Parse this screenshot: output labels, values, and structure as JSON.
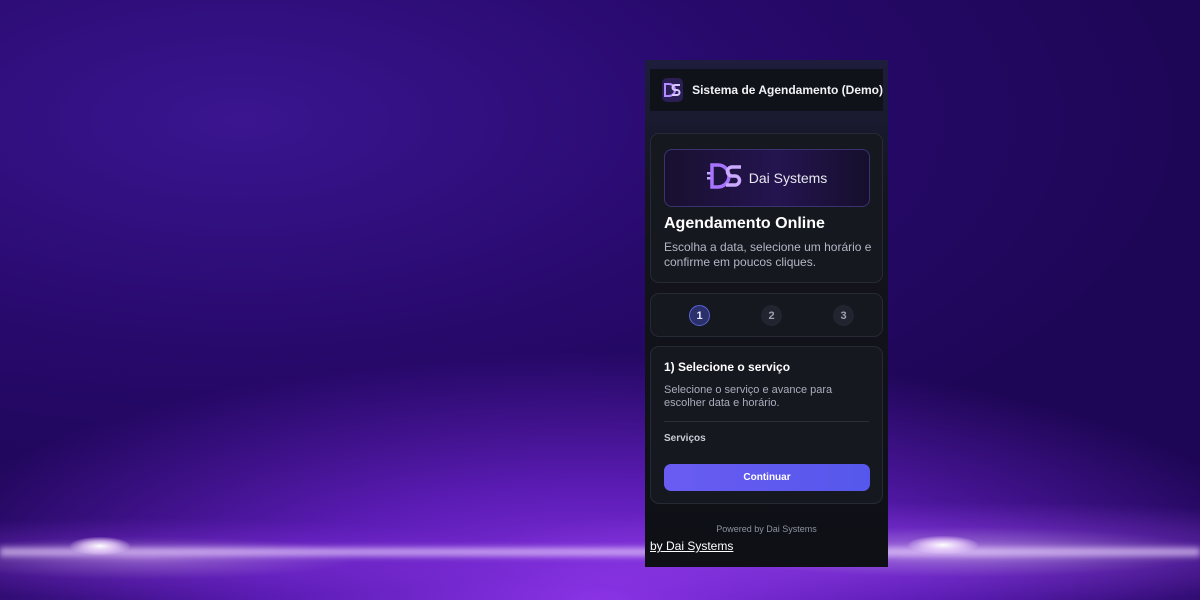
{
  "header": {
    "logo_icon": "ds-logo-icon",
    "title": "Sistema de Agendamento (Demo)"
  },
  "hero": {
    "brand_icon": "ds-logo-icon",
    "brand_name": "Dai Systems",
    "title": "Agendamento Online",
    "description": "Escolha a data, selecione um horário e confirme em poucos cliques."
  },
  "steps": [
    {
      "label": "1",
      "active": true
    },
    {
      "label": "2",
      "active": false
    },
    {
      "label": "3",
      "active": false
    }
  ],
  "service_step": {
    "title": "1) Selecione o serviço",
    "description": "Selecione o serviço e avance para escolher data e horário.",
    "field_label": "Serviços",
    "continue_label": "Continuar"
  },
  "footer": {
    "powered_by": "Powered by Dai Systems",
    "link_text": "by Dai Systems"
  },
  "colors": {
    "accent": "#6a5cf2",
    "panel_bg": "#161820",
    "page_bg": "#2a0c6e"
  }
}
